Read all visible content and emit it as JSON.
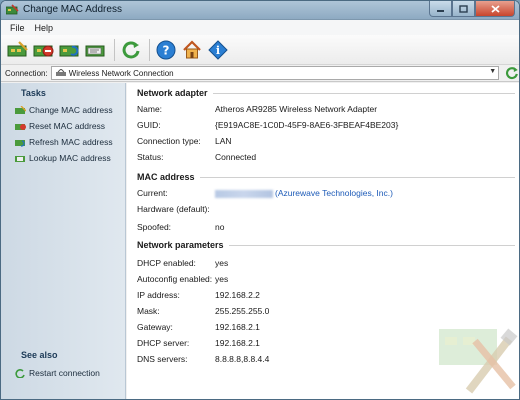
{
  "window": {
    "title": "Change MAC Address"
  },
  "menu": [
    "File",
    "Help"
  ],
  "connection": {
    "label": "Connection:",
    "value": "Wireless Network Connection"
  },
  "sidebar": {
    "tasks_heading": "Tasks",
    "tasks": [
      {
        "label": "Change MAC address",
        "icon": "change-mac-icon"
      },
      {
        "label": "Reset MAC address",
        "icon": "reset-mac-icon"
      },
      {
        "label": "Refresh MAC address",
        "icon": "refresh-mac-icon"
      },
      {
        "label": "Lookup MAC address",
        "icon": "lookup-mac-icon"
      }
    ],
    "see_also_heading": "See also",
    "see_also": [
      {
        "label": "Restart connection",
        "icon": "restart-connection-icon"
      }
    ]
  },
  "network_adapter": {
    "heading": "Network adapter",
    "rows": [
      {
        "key": "Name:",
        "value": "Atheros AR9285 Wireless Network Adapter"
      },
      {
        "key": "GUID:",
        "value": "{E919AC8E-1C0D-45F9-8AE6-3FBEAF4BE203}"
      },
      {
        "key": "Connection type:",
        "value": "LAN"
      },
      {
        "key": "Status:",
        "value": "Connected"
      }
    ]
  },
  "mac_address": {
    "heading": "MAC address",
    "current_key": "Current:",
    "current_vendor": "(Azurewave Technologies, Inc.)",
    "hardware_key": "Hardware (default):",
    "hardware_value": "",
    "spoofed_key": "Spoofed:",
    "spoofed_value": "no"
  },
  "network_parameters": {
    "heading": "Network parameters",
    "rows": [
      {
        "key": "DHCP enabled:",
        "value": "yes"
      },
      {
        "key": "Autoconfig enabled:",
        "value": "yes"
      },
      {
        "key": "IP address:",
        "value": "192.168.2.2"
      },
      {
        "key": "Mask:",
        "value": "255.255.255.0"
      },
      {
        "key": "Gateway:",
        "value": "192.168.2.1"
      },
      {
        "key": "DHCP server:",
        "value": "192.168.2.1"
      },
      {
        "key": "DNS servers:",
        "value": "8.8.8.8,8.8.4.4"
      }
    ]
  },
  "colors": {
    "link": "#1d5bb8",
    "sidebar": "#cdd9e4",
    "accent": "#1c3a57"
  }
}
